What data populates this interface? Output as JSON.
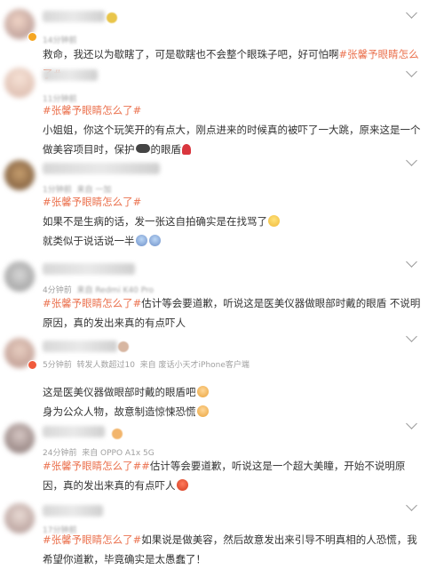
{
  "colors": {
    "tag": "#eb7350",
    "meta": "#a0a0a0",
    "text": "#333333",
    "badge": "#f5a623"
  },
  "icons": {
    "collapse": "chevron-down-icon",
    "verified": "verified-badge-icon"
  },
  "comments": [
    {
      "meta": "14分钟前",
      "text": "救命，我还以为歇瞎了，可是歇瞎也不会整个眼珠子吧，好可怕啊",
      "tag": "#张馨予眼睛怎么了#"
    },
    {
      "meta": "11分钟前",
      "tag": "#张馨予眼睛怎么了#",
      "text": "小姐姐，你这个玩笑开的有点大，刚点进来的时候真的被吓了一大跳，原来这是一个做美容项目时，保护",
      "text_tail": "的眼盾"
    },
    {
      "meta_time": "1分钟前",
      "meta_source": "来自 一加",
      "tag": "#张馨予眼睛怎么了#",
      "line1": "如果不是生病的话，发一张这自拍确实是在找骂了",
      "line2": "就类似于说话说一半"
    },
    {
      "meta_time": "4分钟前",
      "meta_source": "来自 Redmi K40 Pro",
      "tag": "#张馨予眼睛怎么了#",
      "text": "估计等会要道歉，听说这是医美仪器做眼部时戴的眼盾 不说明原因，真的发出来真的有点吓人"
    },
    {
      "meta_time": "5分钟前",
      "meta_repost": "转发人数超过10",
      "meta_source": "来自 废话小天才iPhone客户端",
      "line1": "这是医美仪器做眼部时戴的眼盾吧",
      "line2": "身为公众人物，故意制造惊悚恐慌"
    },
    {
      "meta_time": "24分钟前",
      "meta_source": "来自 OPPO A1x 5G",
      "tag1": "#张馨予眼睛怎么了#",
      "tag2": "#",
      "text": "估计等会要道歉，听说这是一个超大美瞳，开始不说明原因，真的发出来真的有点吓人"
    },
    {
      "meta": "17分钟前",
      "tag": "#张馨予眼睛怎么了#",
      "text": "如果说是做美容，然后故意发出来引导不明真相的人恐慌，我希望你道歉，毕竟确实是太愚蠢了！"
    }
  ]
}
